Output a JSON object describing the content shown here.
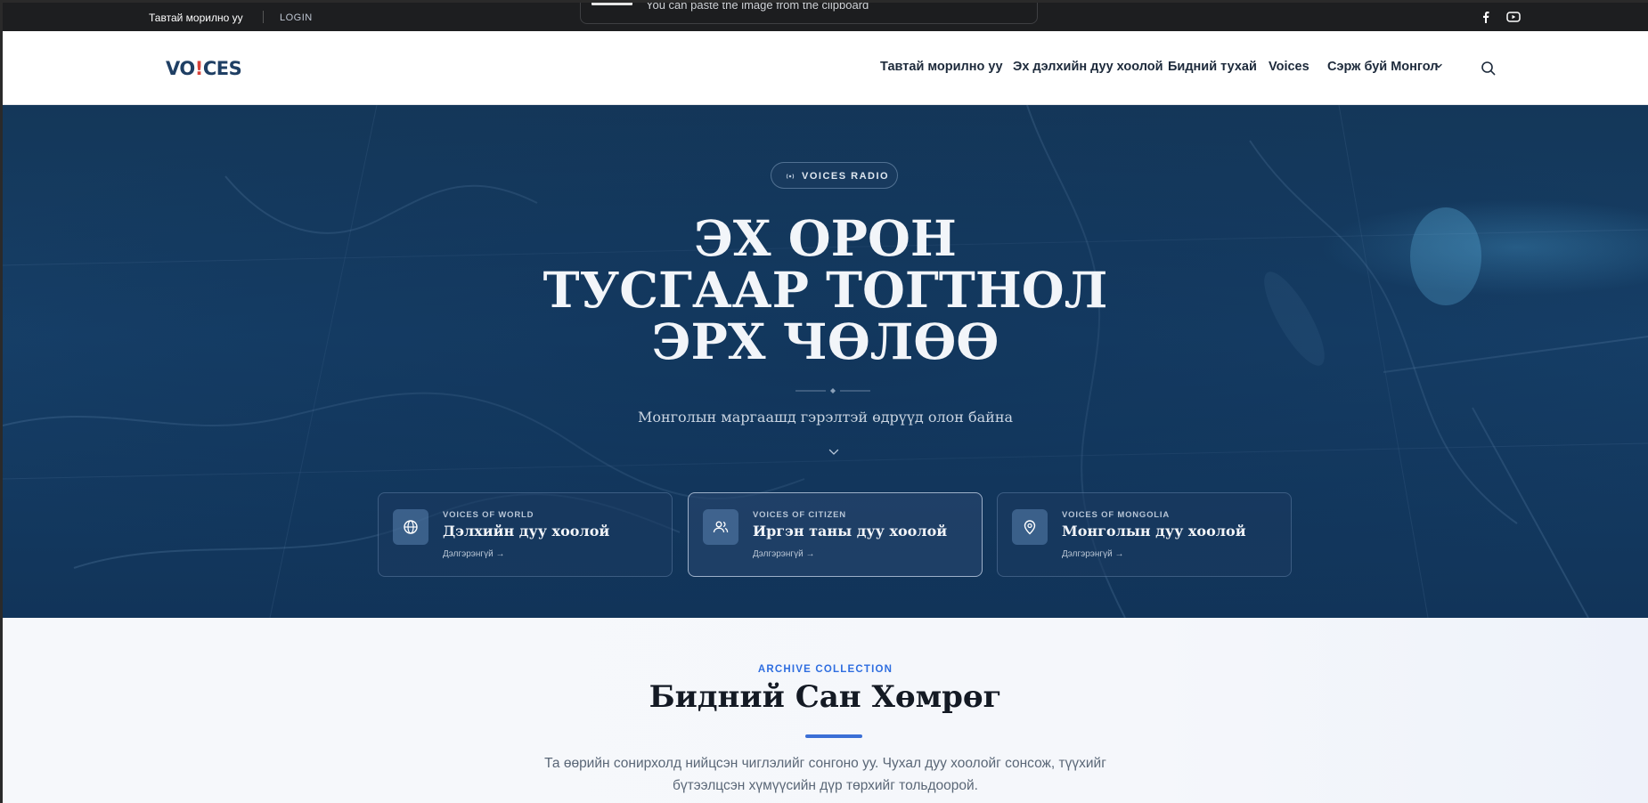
{
  "topbar": {
    "welcome": "Тавтай морилно уу",
    "login": "LOGIN",
    "icons": [
      "facebook-icon",
      "youtube-icon"
    ]
  },
  "notification": {
    "message": "You can paste the image from the clipboard"
  },
  "nav": {
    "logo_pre": "VO",
    "logo_bang": "!",
    "logo_post": "CES",
    "items": [
      {
        "label": "Тавтай морилно уу"
      },
      {
        "label": "Эх дэлхийн дуу хоолой"
      },
      {
        "label": "Бидний тухай"
      },
      {
        "label": "Voices"
      },
      {
        "label": "Сэрж буй Монгол"
      }
    ]
  },
  "hero": {
    "badge": "VOICES RADIO",
    "title_lines": [
      "ЭХ ОРОН",
      "ТУСГААР ТОГТНОЛ",
      "ЭРХ ЧӨЛӨӨ"
    ],
    "subtitle": "Монголын маргаашд гэрэлтэй өдрүүд олон байна",
    "cards": [
      {
        "kicker": "VOICES OF WORLD",
        "title": "Дэлхийн дуу хоолой",
        "more": "Дэлгэрэнгүй →",
        "icon": "globe-icon"
      },
      {
        "kicker": "VOICES OF CITIZEN",
        "title": "Иргэн таны дуу хоолой",
        "more": "Дэлгэрэнгүй →",
        "icon": "users-icon"
      },
      {
        "kicker": "VOICES OF MONGOLIA",
        "title": "Монголын дуу хоолой",
        "more": "Дэлгэрэнгүй →",
        "icon": "map-pin-icon"
      }
    ]
  },
  "archive": {
    "kicker": "ARCHIVE COLLECTION",
    "title": "Бидний Сан Хөмрөг",
    "desc_line1": "Та өөрийн сонирхолд нийцсэн чиглэлийг сонгоно уу. Чухал дуу хоолойг сонсож, түүхийг",
    "desc_line2": "бүтээлцсэн хүмүүсийн дүр төрхийг тольдоорой."
  },
  "colors": {
    "accent": "#3b6fd6",
    "logo": "#1f3f64",
    "logo_bang": "#d8423a",
    "hero_bg": "#163f68",
    "topbar": "#1d1e20"
  }
}
